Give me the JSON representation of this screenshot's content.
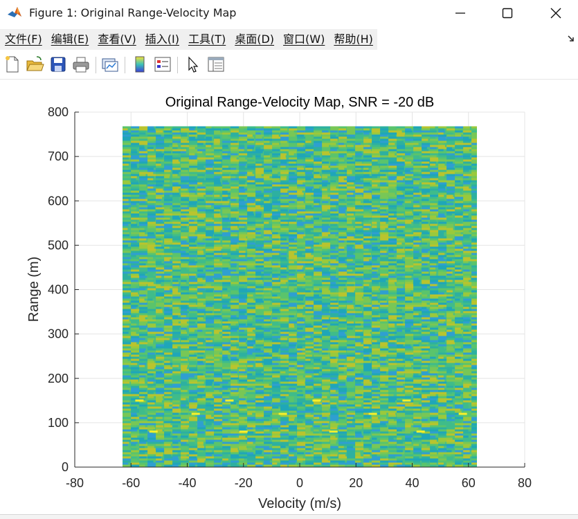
{
  "window": {
    "title": "Figure 1: Original Range-Velocity Map",
    "app_icon": "matlab-logo-icon",
    "controls": [
      "minimize-icon",
      "maximize-icon",
      "close-icon"
    ]
  },
  "menu": {
    "items": [
      {
        "label": "文件(F)"
      },
      {
        "label": "编辑(E)"
      },
      {
        "label": "查看(V)"
      },
      {
        "label": "插入(I)"
      },
      {
        "label": "工具(T)"
      },
      {
        "label": "桌面(D)"
      },
      {
        "label": "窗口(W)"
      },
      {
        "label": "帮助(H)"
      }
    ],
    "overflow_icon": "dock-arrow-icon"
  },
  "toolbar": {
    "buttons": [
      "new-figure-icon",
      "open-file-icon",
      "save-icon",
      "print-icon",
      "link-plot-icon",
      "colorbar-icon",
      "legend-icon",
      "select-pointer-icon",
      "property-inspector-icon"
    ]
  },
  "chart_data": {
    "type": "heatmap",
    "title": "Original Range-Velocity Map, SNR = -20 dB",
    "xlabel": "Velocity (m/s)",
    "ylabel": "Range (m)",
    "xlim": [
      -80,
      80
    ],
    "ylim": [
      0,
      800
    ],
    "xticks": [
      -80,
      -60,
      -40,
      -20,
      0,
      20,
      40,
      60,
      80
    ],
    "yticks": [
      0,
      100,
      200,
      300,
      400,
      500,
      600,
      700,
      800
    ],
    "grid": true,
    "image_extent": {
      "x": [
        -63,
        63
      ],
      "y": [
        0,
        768
      ]
    },
    "colormap": "parula",
    "noise_colors": [
      "#2db0a0",
      "#3fbc8a",
      "#5ac46c",
      "#78c756",
      "#9ac93c",
      "#b9c42e",
      "#1fa6b8",
      "#2f9fd0"
    ],
    "targets": [
      {
        "velocity": -57,
        "range": 150
      },
      {
        "velocity": -52,
        "range": 80
      },
      {
        "velocity": -37,
        "range": 120
      },
      {
        "velocity": -25,
        "range": 150
      },
      {
        "velocity": -20,
        "range": 80
      },
      {
        "velocity": -6,
        "range": 120
      },
      {
        "velocity": 6,
        "range": 150
      },
      {
        "velocity": 12,
        "range": 80
      },
      {
        "velocity": 26,
        "range": 120
      },
      {
        "velocity": 38,
        "range": 150
      },
      {
        "velocity": 43,
        "range": 80
      },
      {
        "velocity": 58,
        "range": 120
      }
    ]
  }
}
